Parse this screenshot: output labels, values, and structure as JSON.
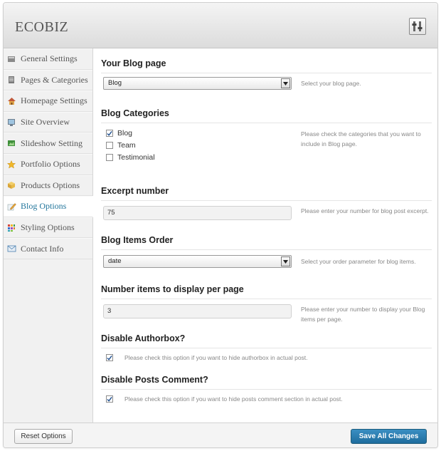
{
  "header": {
    "title": "ECOBIZ",
    "tools_icon": "tools-icon"
  },
  "sidebar": {
    "items": [
      {
        "label": "General Settings",
        "icon": "gear-icon",
        "active": false
      },
      {
        "label": "Pages & Categories",
        "icon": "pages-icon",
        "active": false
      },
      {
        "label": "Homepage Settings",
        "icon": "home-icon",
        "active": false
      },
      {
        "label": "Site Overview",
        "icon": "monitor-icon",
        "active": false
      },
      {
        "label": "Slideshow Setting",
        "icon": "slideshow-icon",
        "active": false
      },
      {
        "label": "Portfolio Options",
        "icon": "star-icon",
        "active": false
      },
      {
        "label": "Products Options",
        "icon": "box-icon",
        "active": false
      },
      {
        "label": "Blog Options",
        "icon": "pencil-icon",
        "active": true
      },
      {
        "label": "Styling Options",
        "icon": "palette-icon",
        "active": false
      },
      {
        "label": "Contact Info",
        "icon": "mail-icon",
        "active": false
      }
    ]
  },
  "main": {
    "blog_page": {
      "title": "Your Blog page",
      "value": "Blog",
      "description": "Select your blog page."
    },
    "blog_categories": {
      "title": "Blog Categories",
      "options": [
        {
          "label": "Blog",
          "checked": true
        },
        {
          "label": "Team",
          "checked": false
        },
        {
          "label": "Testimonial",
          "checked": false
        }
      ],
      "description": "Please check the categories that you want to include in Blog page."
    },
    "excerpt": {
      "title": "Excerpt number",
      "value": "75",
      "description": "Please enter your number for blog post excerpt."
    },
    "items_order": {
      "title": "Blog Items Order",
      "value": "date",
      "description": "Select your order parameter for blog items."
    },
    "per_page": {
      "title": "Number items to display per page",
      "value": "3",
      "description": "Please enter your number to display your Blog items per page."
    },
    "authorbox": {
      "title": "Disable Authorbox?",
      "checked": true,
      "description": "Please check this option if you want to hide authorbox in actual post."
    },
    "posts_comment": {
      "title": "Disable Posts Comment?",
      "checked": true,
      "description": "Please check this option if you want to hide posts comment section in actual post."
    }
  },
  "footer": {
    "reset_label": "Reset Options",
    "save_label": "Save All Changes"
  },
  "colors": {
    "active_nav": "#21759b",
    "save_button": "#2a7db0"
  }
}
